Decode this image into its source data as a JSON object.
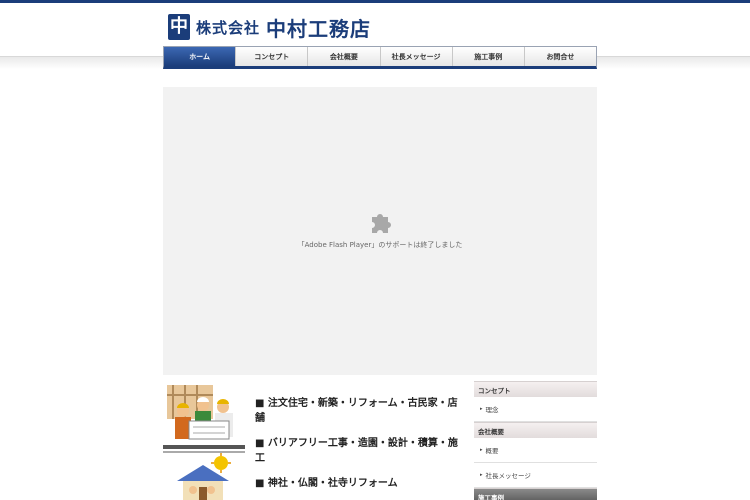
{
  "header": {
    "logo_mark": "中",
    "logo_prefix": "株式会社",
    "logo_name": "中村工務店"
  },
  "nav": {
    "items": [
      {
        "label": "ホーム",
        "active": true
      },
      {
        "label": "コンセプト",
        "active": false
      },
      {
        "label": "会社概要",
        "active": false
      },
      {
        "label": "社長メッセージ",
        "active": false
      },
      {
        "label": "施工事例",
        "active": false
      },
      {
        "label": "お問合せ",
        "active": false
      }
    ]
  },
  "flash": {
    "message": "「Adobe Flash Player」のサポートは終了しました",
    "icon": "puzzle-piece-icon"
  },
  "features": [
    "■ 注文住宅・新築・リフォーム・古民家・店舗",
    "■ バリアフリー工事・造園・設計・積算・施工",
    "■ 神社・仏閣・社寺リフォーム"
  ],
  "sidebar": {
    "sections": [
      {
        "title": "コンセプト",
        "items": [
          "理念"
        ]
      },
      {
        "title": "会社概要",
        "items": [
          "概要",
          "社長メッセージ"
        ]
      },
      {
        "title": "施工事例",
        "items": []
      }
    ]
  },
  "colors": {
    "brand": "#1b3d7a",
    "flash_bg": "#f2f2f2"
  }
}
